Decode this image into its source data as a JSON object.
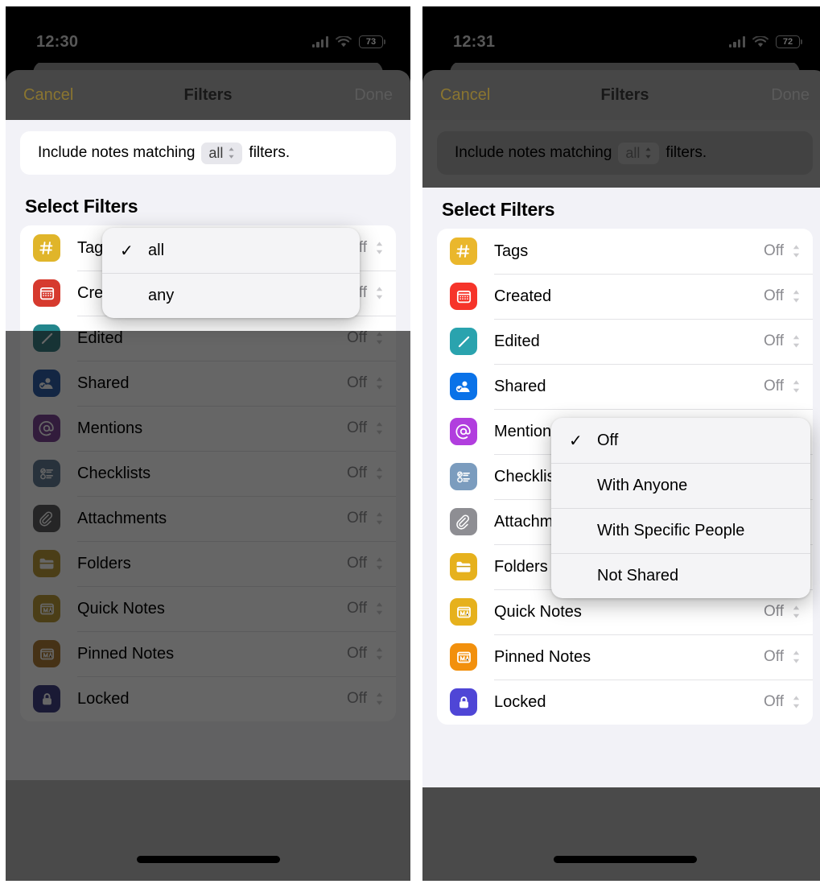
{
  "panels": [
    {
      "id": "left",
      "status": {
        "time": "12:30",
        "battery": "73",
        "wifi_icon": "wifi-icon",
        "signal_icon": "cellular-signal-icon"
      },
      "nav": {
        "cancel": "Cancel",
        "title": "Filters",
        "done": "Done"
      },
      "match": {
        "prefix": "Include notes matching",
        "value": "all",
        "suffix": "filters.",
        "chip_icon": "up-down-chevron-icon"
      },
      "section_title": "Select Filters",
      "rows": [
        {
          "label": "Tags",
          "value": "Off",
          "icon": "hashtag-icon",
          "color": "#e0b52a"
        },
        {
          "label": "Created",
          "value": "Off",
          "icon": "calendar-icon",
          "color": "#d63a2e"
        },
        {
          "label": "Edited",
          "value": "Off",
          "icon": "pencil-icon",
          "color": "#23868c"
        },
        {
          "label": "Shared",
          "value": "Off",
          "icon": "shared-user-icon",
          "color": "#1f62c4"
        },
        {
          "label": "Mentions",
          "value": "Off",
          "icon": "at-sign-icon",
          "color": "#8b3fad"
        },
        {
          "label": "Checklists",
          "value": "Off",
          "icon": "checklist-icon",
          "color": "#5d7da0"
        },
        {
          "label": "Attachments",
          "value": "Off",
          "icon": "paperclip-icon",
          "color": "#5c5c60"
        },
        {
          "label": "Folders",
          "value": "Off",
          "icon": "folder-icon",
          "color": "#c79a15"
        },
        {
          "label": "Quick Notes",
          "value": "Off",
          "icon": "quick-note-icon",
          "color": "#c79a15"
        },
        {
          "label": "Pinned Notes",
          "value": "Off",
          "icon": "pinned-note-icon",
          "color": "#c07c18"
        },
        {
          "label": "Locked",
          "value": "Off",
          "icon": "lock-icon",
          "color": "#3f3f9e"
        }
      ],
      "menu": {
        "name": "match-mode-menu",
        "items": [
          {
            "label": "all",
            "checked": true
          },
          {
            "label": "any",
            "checked": false
          }
        ]
      }
    },
    {
      "id": "right",
      "status": {
        "time": "12:31",
        "battery": "72",
        "wifi_icon": "wifi-icon",
        "signal_icon": "cellular-signal-icon"
      },
      "nav": {
        "cancel": "Cancel",
        "title": "Filters",
        "done": "Done"
      },
      "match": {
        "prefix": "Include notes matching",
        "value": "all",
        "suffix": "filters.",
        "chip_icon": "up-down-chevron-icon"
      },
      "section_title": "Select Filters",
      "rows": [
        {
          "label": "Tags",
          "value": "Off",
          "icon": "hashtag-icon",
          "color": "#eab72c"
        },
        {
          "label": "Created",
          "value": "Off",
          "icon": "calendar-icon",
          "color": "#f6342a"
        },
        {
          "label": "Edited",
          "value": "Off",
          "icon": "pencil-icon",
          "color": "#2aa3ae"
        },
        {
          "label": "Shared",
          "value": "Off",
          "icon": "shared-user-icon",
          "color": "#0a72e8"
        },
        {
          "label": "Mentions",
          "value": "Off",
          "icon": "at-sign-icon",
          "color": "#b13ede"
        },
        {
          "label": "Checklists",
          "value": "Off",
          "icon": "checklist-icon",
          "color": "#7b9cbe"
        },
        {
          "label": "Attachments",
          "value": "Off",
          "icon": "paperclip-icon",
          "color": "#8e8e93"
        },
        {
          "label": "Folders",
          "value": "Off",
          "icon": "folder-icon",
          "color": "#e6b11d"
        },
        {
          "label": "Quick Notes",
          "value": "Off",
          "icon": "quick-note-icon",
          "color": "#e6b11d"
        },
        {
          "label": "Pinned Notes",
          "value": "Off",
          "icon": "pinned-note-icon",
          "color": "#f2900d"
        },
        {
          "label": "Locked",
          "value": "Off",
          "icon": "lock-icon",
          "color": "#4f46d6"
        }
      ],
      "menu": {
        "name": "shared-filter-menu",
        "items": [
          {
            "label": "Off",
            "checked": true
          },
          {
            "label": "With Anyone",
            "checked": false
          },
          {
            "label": "With Specific People",
            "checked": false
          },
          {
            "label": "Not Shared",
            "checked": false
          }
        ]
      }
    }
  ],
  "colors": {
    "accent_yellow": "#d8a90f",
    "sheet_gray": "#474747",
    "light_bg": "#f2f2f7",
    "card_white": "#ffffff",
    "value_gray": "#8b8b90"
  }
}
